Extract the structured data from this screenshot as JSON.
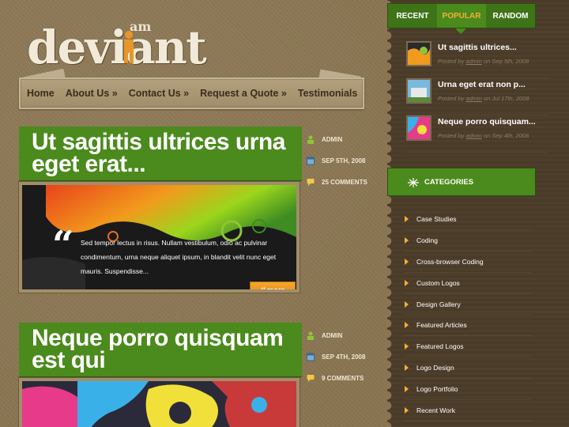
{
  "logo": {
    "prefix": "am",
    "name": "deviant"
  },
  "nav": {
    "items": [
      "Home",
      "About Us »",
      "Contact Us »",
      "Request a Quote »",
      "Testimonials"
    ]
  },
  "posts": [
    {
      "title": "Ut sagittis ultrices urna eget erat...",
      "author": "ADMIN",
      "date": "SEP 5TH, 2008",
      "comments": "25 COMMENTS",
      "excerpt": "Sed tempor lectus in risus. Nullam vestibulum, odio ac pulvinar condimentum, urna neque aliquet ipsum, in blandit velit nunc eget mauris. Suspendisse...",
      "more_label": "more"
    },
    {
      "title": "Neque porro quisquam est qui",
      "author": "ADMIN",
      "date": "SEP 4TH, 2008",
      "comments": "9 COMMENTS"
    }
  ],
  "sidebar": {
    "tabs": [
      "RECENT",
      "POPULAR",
      "RANDOM"
    ],
    "active_tab": "POPULAR",
    "recent": [
      {
        "title": "Ut sagittis ultrices...",
        "posted_by": "Posted by",
        "author": "admin",
        "date": "on Sep 5th, 2008"
      },
      {
        "title": "Urna eget erat non p...",
        "posted_by": "Posted by",
        "author": "admin",
        "date": "on Jul 17th, 2008"
      },
      {
        "title": "Neque porro quisquam...",
        "posted_by": "Posted by",
        "author": "admin",
        "date": "on Sep 4th, 2008"
      }
    ],
    "categories_title": "CATEGORIES",
    "categories": [
      "Case Studies",
      "Coding",
      "Cross-browser Coding",
      "Custom Logos",
      "Design Gallery",
      "Featured Articles",
      "Featured Logos",
      "Logo Design",
      "Logo Portfolio",
      "Recent Work"
    ]
  },
  "colors": {
    "green": "#4b8a1c",
    "orange": "#f2b03a",
    "paper": "#8a7552",
    "sidebar": "#4b3c2a"
  },
  "icons": {
    "author": "user-icon",
    "date": "calendar-icon",
    "comments": "comment-bubble-icon",
    "quote": "quote-icon",
    "categories": "star-burst-icon"
  }
}
